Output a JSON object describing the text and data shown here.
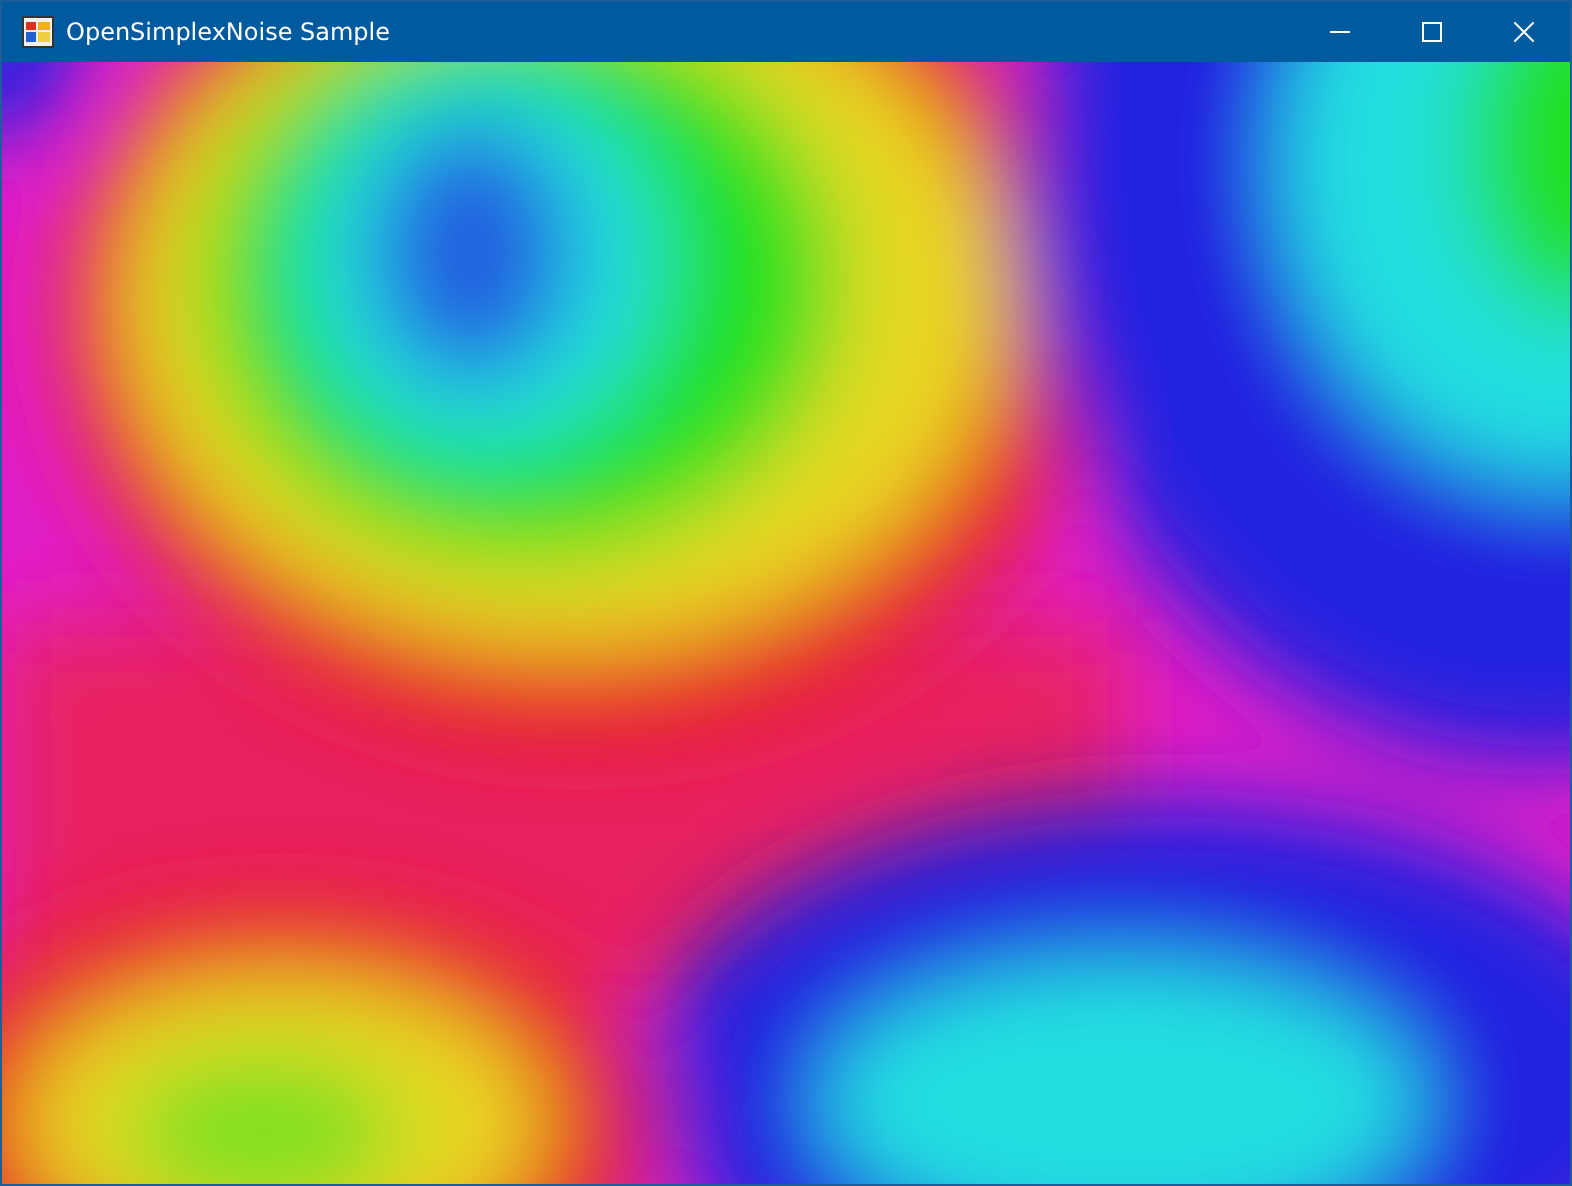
{
  "window": {
    "title": "OpenSimplexNoise Sample"
  }
}
